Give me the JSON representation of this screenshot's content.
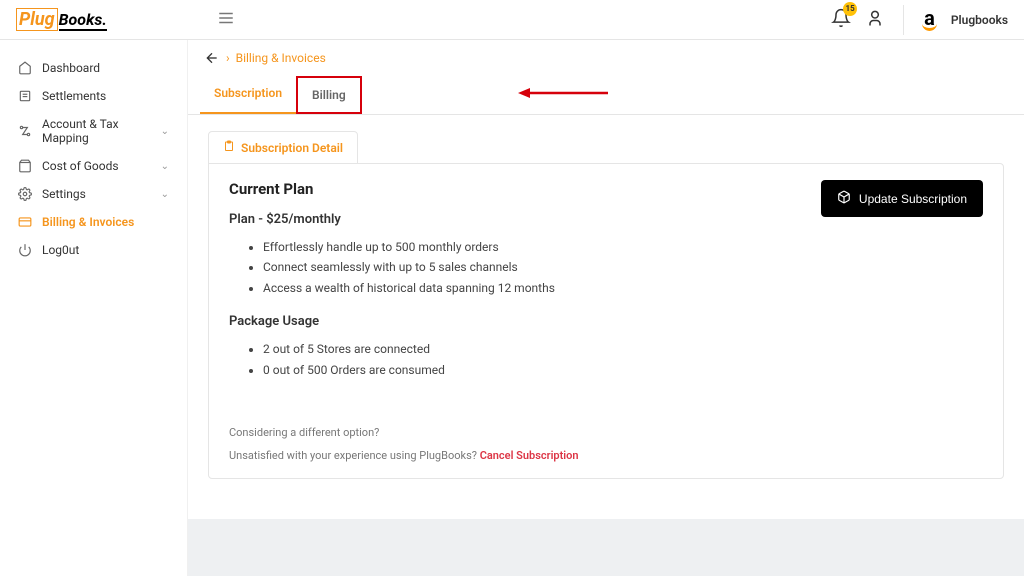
{
  "header": {
    "logo_part1": "Plug",
    "logo_part2": "Books.",
    "notif_count": "15",
    "company": "Plugbooks"
  },
  "sidebar": {
    "items": [
      {
        "label": "Dashboard"
      },
      {
        "label": "Settlements"
      },
      {
        "label": "Account & Tax Mapping"
      },
      {
        "label": "Cost of Goods"
      },
      {
        "label": "Settings"
      },
      {
        "label": "Billing & Invoices"
      },
      {
        "label": "Log0ut"
      }
    ]
  },
  "breadcrumb": {
    "text": "Billing & Invoices"
  },
  "tabs": {
    "subscription": "Subscription",
    "billing": "Billing"
  },
  "subscription": {
    "pill_label": "Subscription Detail",
    "current_plan_title": "Current Plan",
    "plan_line": "Plan - $25/monthly",
    "plan_points": [
      "Effortlessly handle up to 500 monthly orders",
      "Connect seamlessly with up to 5 sales channels",
      "Access a wealth of historical data spanning 12 months"
    ],
    "package_usage_title": "Package Usage",
    "usage_points": [
      "2 out of 5 Stores are connected",
      "0 out of 500 Orders are consumed"
    ],
    "considering": "Considering a different option?",
    "unsat_prefix": "Unsatisfied with your experience using PlugBooks? ",
    "cancel_label": "Cancel Subscription",
    "update_btn": "Update Subscription"
  }
}
